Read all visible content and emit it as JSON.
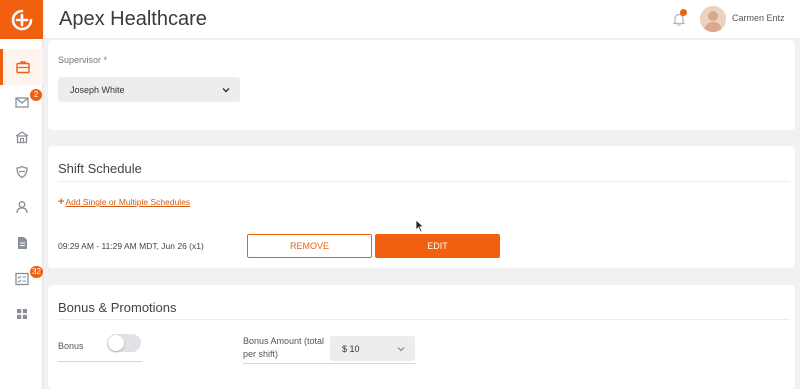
{
  "app": {
    "title": "Apex Healthcare"
  },
  "user": {
    "name": "Carmen Entz"
  },
  "sidebar": {
    "items": [
      {
        "name": "jobs",
        "icon": "briefcase-icon",
        "active": true
      },
      {
        "name": "messages",
        "icon": "mail-icon",
        "badge": "2"
      },
      {
        "name": "facilities",
        "icon": "building-icon"
      },
      {
        "name": "credentials",
        "icon": "shield-icon"
      },
      {
        "name": "profile",
        "icon": "person-icon"
      },
      {
        "name": "documents",
        "icon": "document-icon"
      },
      {
        "name": "timesheets",
        "icon": "checklist-icon",
        "badge": "32"
      },
      {
        "name": "apps",
        "icon": "grid-icon"
      }
    ]
  },
  "supervisor": {
    "label": "Supervisor *",
    "value": "Joseph White"
  },
  "shift_schedule": {
    "title": "Shift Schedule",
    "add_link_icon": "+",
    "add_link": "Add Single or Multiple Schedules",
    "entry": "09:29 AM - 11:29 AM  MDT, Jun 26 (x1)",
    "remove_label": "REMOVE",
    "edit_label": "EDIT"
  },
  "bonus": {
    "title": "Bonus & Promotions",
    "bonus_label": "Bonus",
    "bonus_enabled": false,
    "amount_label_line1": "Bonus Amount (total",
    "amount_label_line2": "per shift)",
    "amount_value": "$ 10"
  },
  "colors": {
    "accent": "#f0600f",
    "background": "#f1f1f4",
    "card": "#ffffff"
  }
}
